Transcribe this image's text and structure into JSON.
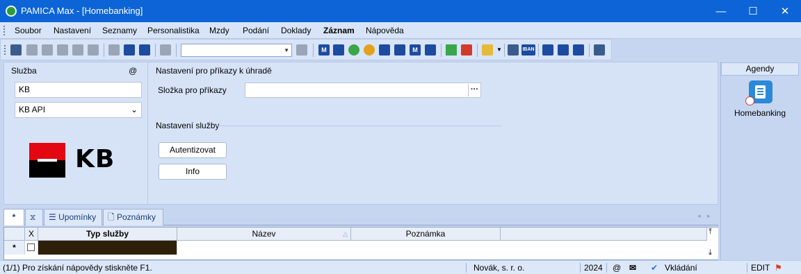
{
  "window": {
    "title": "PAMICA Max - [Homebanking]"
  },
  "menu": [
    "Soubor",
    "Nastavení",
    "Seznamy",
    "Personalistika",
    "Mzdy",
    "Podání",
    "Doklady",
    "Záznam",
    "Nápověda"
  ],
  "menu_bold_index": 7,
  "toolbar": {
    "combo_value": "",
    "icons": [
      "new-record-icon",
      "copy-icon",
      "print-icon",
      "print-preview-icon",
      "export-icon",
      "delete-icon",
      "page-icon",
      "save-icon",
      "save-all-icon",
      "paste-icon",
      "filter-icon",
      "m-report-icon",
      "m-filter-icon",
      "green-user-icon",
      "orange-user-icon",
      "calendar-icon",
      "check-month-icon",
      "m-box-icon",
      "m-add-icon",
      "green-flag-icon",
      "red-flag-icon",
      "folder-icon",
      "calculator-icon",
      "iban-icon",
      "window-icon",
      "list-icon",
      "list2-icon",
      "help-cursor-icon"
    ],
    "iban_label": "IBAN",
    "m_label": "M"
  },
  "left": {
    "section_label": "Služba",
    "at_sign": "@",
    "service_name": "KB",
    "service_type": "KB API",
    "logo_text": "KB"
  },
  "settings": {
    "payments_heading": "Nastavení pro příkazy k úhradě",
    "folder_label": "Složka pro příkazy",
    "folder_value": "",
    "browse_label": "···",
    "service_heading": "Nastavení služby",
    "auth_button": "Autentizovat",
    "info_button": "Info"
  },
  "agendy": {
    "header": "Agendy",
    "items": [
      {
        "label": "Homebanking"
      }
    ]
  },
  "tabs": {
    "star": "*",
    "items": [
      "Upomínky",
      "Poznámky"
    ]
  },
  "grid": {
    "x_header": "X",
    "columns": [
      "Typ služby",
      "Název",
      "Poznámka"
    ],
    "new_row_marker": "*"
  },
  "status": {
    "help": "(1/1) Pro získání nápovědy stiskněte F1.",
    "company": "Novák, s. r. o.",
    "year": "2024",
    "at": "@",
    "mode": "Vkládání",
    "edit": "EDIT"
  }
}
